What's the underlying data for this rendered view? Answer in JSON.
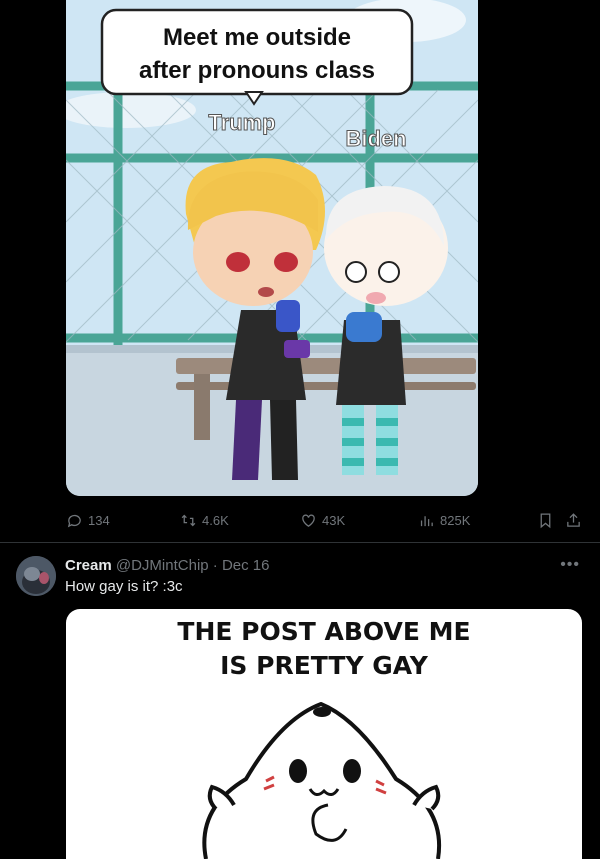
{
  "post1": {
    "image": {
      "speech_bubble": [
        "Meet me outside",
        "after pronouns class"
      ],
      "label_left": "Trump",
      "label_right": "Biden"
    },
    "actions": {
      "replies": "134",
      "reposts": "4.6K",
      "likes": "43K",
      "views": "825K"
    }
  },
  "post2": {
    "author_name": "Cream",
    "handle_and_date": "@DJMintChip · Dec 16",
    "text": "How gay is it? :3c",
    "image": {
      "caption_line1": "THE POST ABOVE ME",
      "caption_line2": "IS PRETTY GAY"
    }
  },
  "icons": {
    "reply": "reply-icon",
    "repost": "repost-icon",
    "like": "heart-icon",
    "views": "views-icon",
    "bookmark": "bookmark-icon",
    "share": "share-icon",
    "more": "more-icon"
  },
  "colors": {
    "background": "#000000",
    "text": "#e7e9ea",
    "muted": "#71767b",
    "divider": "#2f3336"
  }
}
